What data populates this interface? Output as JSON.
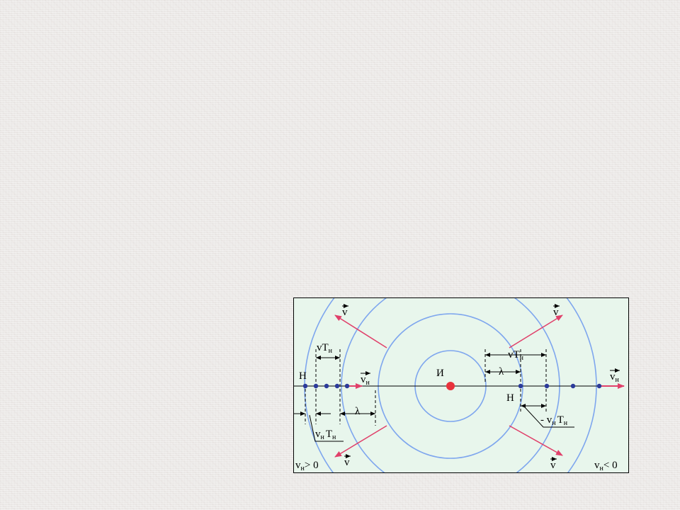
{
  "colors": {
    "background": "#eceae8",
    "figure_bg": "#e8f6ec",
    "wavefront": "#7ea6ee",
    "velocity_arrow": "#e0406a",
    "source": "#e8323c",
    "observer": "#2b3a9a",
    "axis": "#000000"
  },
  "figure": {
    "source_label": "И",
    "observer_label": "Н",
    "wave_speed": "v",
    "observer_speed": "v",
    "observer_speed_subscript": "н",
    "period_product": "vT",
    "period_subscript": "н",
    "wavelength": "λ",
    "observer_shift_left": "v",
    "observer_shift_left_sub1": "н",
    "period_T": "T",
    "period_T_sub": "н",
    "observer_shift_right_prefix": "- v",
    "observer_shift_right_sub1": "н",
    "cond_left": "v",
    "cond_left_sub": "н",
    "cond_left_rel": "> 0",
    "cond_right": "v",
    "cond_right_sub": "н",
    "cond_right_rel": "< 0"
  }
}
